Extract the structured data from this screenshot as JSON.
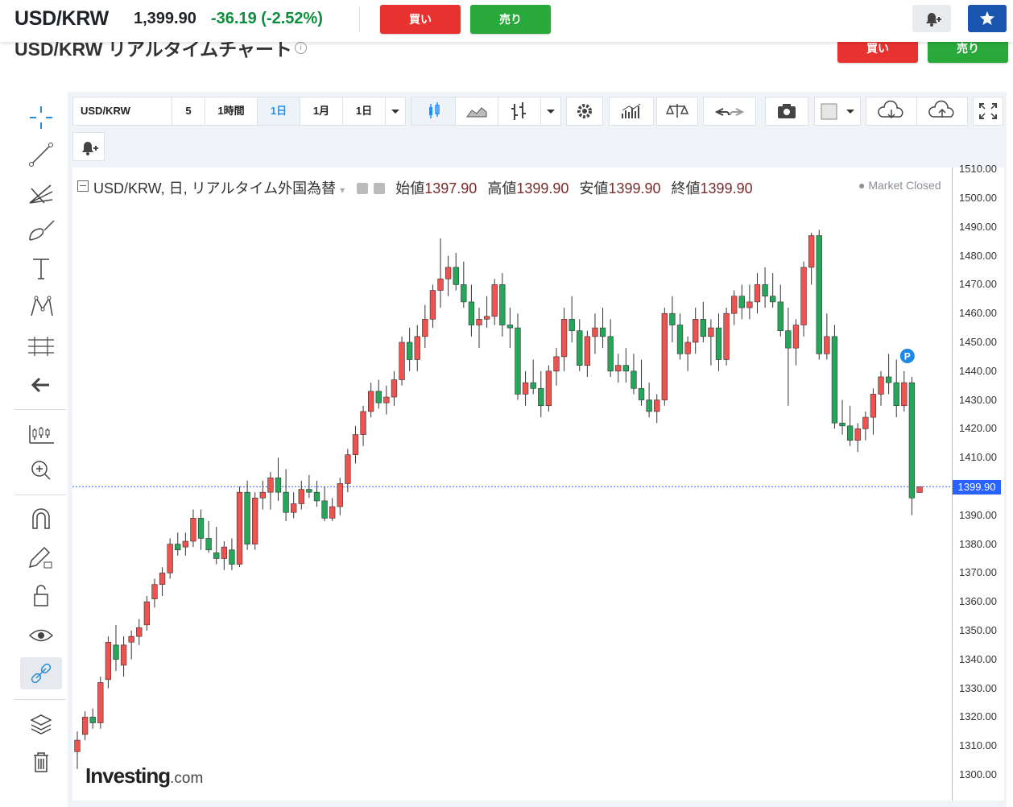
{
  "header": {
    "pair": "USD/KRW",
    "price": "1,399.90",
    "change": "-36.19 (-2.52%)",
    "buy_label": "買い",
    "sell_label": "売り"
  },
  "subheader": {
    "title": "USD/KRW リアルタイムチャート",
    "buy_label": "買い",
    "sell_label": "売り"
  },
  "toolbar": {
    "symbol": "USD/KRW",
    "intervals": [
      "5",
      "1時間",
      "1日",
      "1月",
      "1日"
    ],
    "active_interval": "1日"
  },
  "legend": {
    "title": "USD/KRW, 日, リアルタイム外国為替",
    "open_label": "始値",
    "open": "1397.90",
    "high_label": "高値",
    "high": "1399.90",
    "low_label": "安値",
    "low": "1399.90",
    "close_label": "終値",
    "close": "1399.90",
    "status": "Market Closed"
  },
  "price_axis": {
    "ticks": [
      "1510.00",
      "1500.00",
      "1490.00",
      "1480.00",
      "1470.00",
      "1460.00",
      "1450.00",
      "1440.00",
      "1430.00",
      "1420.00",
      "1410.00",
      "1400.00",
      "1390.00",
      "1380.00",
      "1370.00",
      "1360.00",
      "1350.00",
      "1340.00",
      "1330.00",
      "1320.00",
      "1310.00",
      "1300.00"
    ],
    "current": "1399.90"
  },
  "marker_label": "P",
  "watermark": {
    "brand": "Investing",
    "suffix": ".com"
  },
  "colors": {
    "up": "#ef5350",
    "down": "#26a65b",
    "accent": "#2962ff",
    "buy": "#e8322f",
    "sell": "#28a939"
  },
  "chart_data": {
    "type": "candlestick",
    "ylim": [
      1295,
      1510
    ],
    "current_price": 1399.9,
    "candles": [
      [
        1308,
        1315,
        1302,
        1312
      ],
      [
        1314,
        1322,
        1312,
        1320
      ],
      [
        1320,
        1323,
        1316,
        1318
      ],
      [
        1318,
        1334,
        1316,
        1332
      ],
      [
        1333,
        1348,
        1330,
        1346
      ],
      [
        1345,
        1352,
        1336,
        1340
      ],
      [
        1338,
        1348,
        1334,
        1345
      ],
      [
        1346,
        1350,
        1340,
        1348
      ],
      [
        1348,
        1354,
        1345,
        1351
      ],
      [
        1352,
        1362,
        1350,
        1360
      ],
      [
        1361,
        1368,
        1358,
        1366
      ],
      [
        1366,
        1372,
        1362,
        1370
      ],
      [
        1370,
        1382,
        1368,
        1380
      ],
      [
        1380,
        1384,
        1376,
        1378
      ],
      [
        1379,
        1384,
        1376,
        1381
      ],
      [
        1381,
        1392,
        1379,
        1389
      ],
      [
        1389,
        1392,
        1378,
        1382
      ],
      [
        1382,
        1388,
        1377,
        1378
      ],
      [
        1377,
        1386,
        1373,
        1375
      ],
      [
        1375,
        1381,
        1371,
        1379
      ],
      [
        1378,
        1382,
        1371,
        1373
      ],
      [
        1373,
        1400,
        1372,
        1398
      ],
      [
        1398,
        1402,
        1378,
        1380
      ],
      [
        1380,
        1398,
        1378,
        1396
      ],
      [
        1396,
        1402,
        1392,
        1398
      ],
      [
        1398,
        1405,
        1392,
        1403
      ],
      [
        1403,
        1410,
        1395,
        1398
      ],
      [
        1398,
        1406,
        1388,
        1391
      ],
      [
        1391,
        1398,
        1389,
        1394
      ],
      [
        1394,
        1402,
        1392,
        1399
      ],
      [
        1399,
        1404,
        1396,
        1398
      ],
      [
        1398,
        1402,
        1393,
        1395
      ],
      [
        1395,
        1400,
        1388,
        1389
      ],
      [
        1389,
        1396,
        1388,
        1393
      ],
      [
        1393,
        1403,
        1390,
        1401
      ],
      [
        1401,
        1413,
        1398,
        1411
      ],
      [
        1411,
        1421,
        1408,
        1418
      ],
      [
        1418,
        1428,
        1414,
        1426
      ],
      [
        1426,
        1436,
        1424,
        1433
      ],
      [
        1433,
        1437,
        1427,
        1429
      ],
      [
        1429,
        1435,
        1425,
        1431
      ],
      [
        1431,
        1440,
        1428,
        1437
      ],
      [
        1437,
        1452,
        1435,
        1450
      ],
      [
        1450,
        1455,
        1440,
        1444
      ],
      [
        1444,
        1456,
        1440,
        1452
      ],
      [
        1452,
        1463,
        1448,
        1458
      ],
      [
        1458,
        1470,
        1455,
        1468
      ],
      [
        1468,
        1486,
        1462,
        1472
      ],
      [
        1472,
        1480,
        1466,
        1476
      ],
      [
        1476,
        1481,
        1468,
        1470
      ],
      [
        1470,
        1478,
        1462,
        1464
      ],
      [
        1464,
        1470,
        1452,
        1456
      ],
      [
        1456,
        1462,
        1448,
        1458
      ],
      [
        1458,
        1466,
        1455,
        1459
      ],
      [
        1459,
        1472,
        1456,
        1470
      ],
      [
        1470,
        1474,
        1452,
        1456
      ],
      [
        1456,
        1462,
        1448,
        1455
      ],
      [
        1455,
        1460,
        1430,
        1432
      ],
      [
        1432,
        1440,
        1428,
        1436
      ],
      [
        1436,
        1444,
        1432,
        1434
      ],
      [
        1434,
        1440,
        1424,
        1428
      ],
      [
        1428,
        1442,
        1426,
        1440
      ],
      [
        1440,
        1448,
        1435,
        1445
      ],
      [
        1445,
        1462,
        1440,
        1458
      ],
      [
        1458,
        1466,
        1450,
        1454
      ],
      [
        1454,
        1458,
        1440,
        1442
      ],
      [
        1442,
        1454,
        1438,
        1452
      ],
      [
        1452,
        1460,
        1446,
        1455
      ],
      [
        1455,
        1462,
        1448,
        1452
      ],
      [
        1452,
        1458,
        1438,
        1440
      ],
      [
        1440,
        1446,
        1436,
        1442
      ],
      [
        1442,
        1448,
        1436,
        1440
      ],
      [
        1440,
        1446,
        1432,
        1434
      ],
      [
        1434,
        1444,
        1428,
        1430
      ],
      [
        1430,
        1436,
        1424,
        1426
      ],
      [
        1426,
        1432,
        1422,
        1430
      ],
      [
        1430,
        1462,
        1428,
        1460
      ],
      [
        1460,
        1466,
        1450,
        1456
      ],
      [
        1456,
        1460,
        1444,
        1446
      ],
      [
        1446,
        1452,
        1440,
        1450
      ],
      [
        1450,
        1462,
        1446,
        1458
      ],
      [
        1458,
        1464,
        1450,
        1452
      ],
      [
        1452,
        1458,
        1442,
        1455
      ],
      [
        1455,
        1460,
        1440,
        1444
      ],
      [
        1444,
        1462,
        1442,
        1460
      ],
      [
        1460,
        1468,
        1456,
        1466
      ],
      [
        1466,
        1470,
        1458,
        1462
      ],
      [
        1462,
        1470,
        1458,
        1464
      ],
      [
        1464,
        1474,
        1460,
        1470
      ],
      [
        1470,
        1476,
        1462,
        1466
      ],
      [
        1466,
        1474,
        1462,
        1464
      ],
      [
        1464,
        1470,
        1452,
        1454
      ],
      [
        1454,
        1462,
        1428,
        1448
      ],
      [
        1448,
        1458,
        1442,
        1456
      ],
      [
        1456,
        1478,
        1452,
        1476
      ],
      [
        1476,
        1488,
        1470,
        1487
      ],
      [
        1487,
        1489,
        1444,
        1446
      ],
      [
        1446,
        1460,
        1444,
        1452
      ],
      [
        1452,
        1456,
        1420,
        1422
      ],
      [
        1422,
        1430,
        1418,
        1421
      ],
      [
        1421,
        1428,
        1414,
        1416
      ],
      [
        1416,
        1422,
        1412,
        1420
      ],
      [
        1420,
        1426,
        1416,
        1424
      ],
      [
        1424,
        1434,
        1418,
        1432
      ],
      [
        1432,
        1440,
        1428,
        1438
      ],
      [
        1438,
        1446,
        1432,
        1436
      ],
      [
        1436,
        1444,
        1424,
        1428
      ],
      [
        1428,
        1440,
        1426,
        1436
      ],
      [
        1436,
        1438,
        1390,
        1396
      ],
      [
        1397.9,
        1399.9,
        1397.9,
        1399.9
      ]
    ]
  }
}
